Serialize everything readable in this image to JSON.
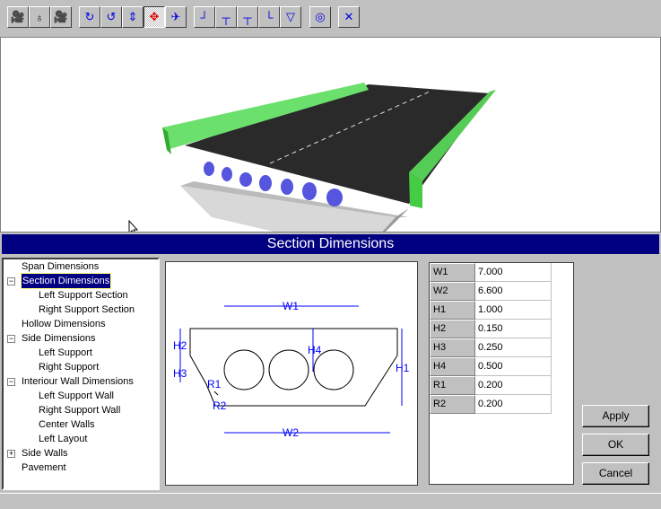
{
  "toolbar": {
    "buttons": [
      {
        "name": "camera-1-icon",
        "glyph": "🎥"
      },
      {
        "name": "light-icon",
        "glyph": "♁"
      },
      {
        "name": "camera-2-icon",
        "glyph": "🎥"
      },
      {
        "name": "rotate-x-icon",
        "glyph": "↻"
      },
      {
        "name": "rotate-y-icon",
        "glyph": "↺"
      },
      {
        "name": "lift-icon",
        "glyph": "⇕"
      },
      {
        "name": "move-icon",
        "glyph": "✥"
      },
      {
        "name": "fly-icon",
        "glyph": "✈"
      },
      {
        "name": "section-1-icon",
        "glyph": "┘"
      },
      {
        "name": "section-2-icon",
        "glyph": "┬"
      },
      {
        "name": "section-3-icon",
        "glyph": "┬"
      },
      {
        "name": "section-4-icon",
        "glyph": "└"
      },
      {
        "name": "section-5-icon",
        "glyph": "▽"
      },
      {
        "name": "hollow-section-icon",
        "glyph": "◎"
      },
      {
        "name": "window-close-icon",
        "glyph": "✕"
      }
    ]
  },
  "title": "Section Dimensions",
  "tree": [
    {
      "label": "Span Dimensions",
      "level": 0
    },
    {
      "label": "Section Dimensions",
      "level": 0,
      "expander": "−",
      "selected": true
    },
    {
      "label": "Left Support Section",
      "level": 1
    },
    {
      "label": "Right Support Section",
      "level": 1
    },
    {
      "label": "Hollow Dimensions",
      "level": 0
    },
    {
      "label": "Side Dimensions",
      "level": 0,
      "expander": "−"
    },
    {
      "label": "Left Support",
      "level": 1
    },
    {
      "label": "Right Support",
      "level": 1
    },
    {
      "label": "Interiour Wall Dimensions",
      "level": 0,
      "expander": "−"
    },
    {
      "label": "Left Support Wall",
      "level": 1
    },
    {
      "label": "Right Support Wall",
      "level": 1
    },
    {
      "label": "Center Walls",
      "level": 1
    },
    {
      "label": "Left Layout",
      "level": 1
    },
    {
      "label": "Side Walls",
      "level": 0,
      "expander": "+"
    },
    {
      "label": "Pavement",
      "level": 0
    }
  ],
  "diagram": {
    "W1": "W1",
    "W2": "W2",
    "H1": "H1",
    "H2": "H2",
    "H3": "H3",
    "H4": "H4",
    "R1": "R1",
    "R2": "R2"
  },
  "params": [
    {
      "name": "W1",
      "value": "7.000"
    },
    {
      "name": "W2",
      "value": "6.600"
    },
    {
      "name": "H1",
      "value": "1.000"
    },
    {
      "name": "H2",
      "value": "0.150"
    },
    {
      "name": "H3",
      "value": "0.250"
    },
    {
      "name": "H4",
      "value": "0.500"
    },
    {
      "name": "R1",
      "value": "0.200"
    },
    {
      "name": "R2",
      "value": "0.200"
    }
  ],
  "buttons": {
    "apply": "Apply",
    "ok": "OK",
    "cancel": "Cancel"
  }
}
